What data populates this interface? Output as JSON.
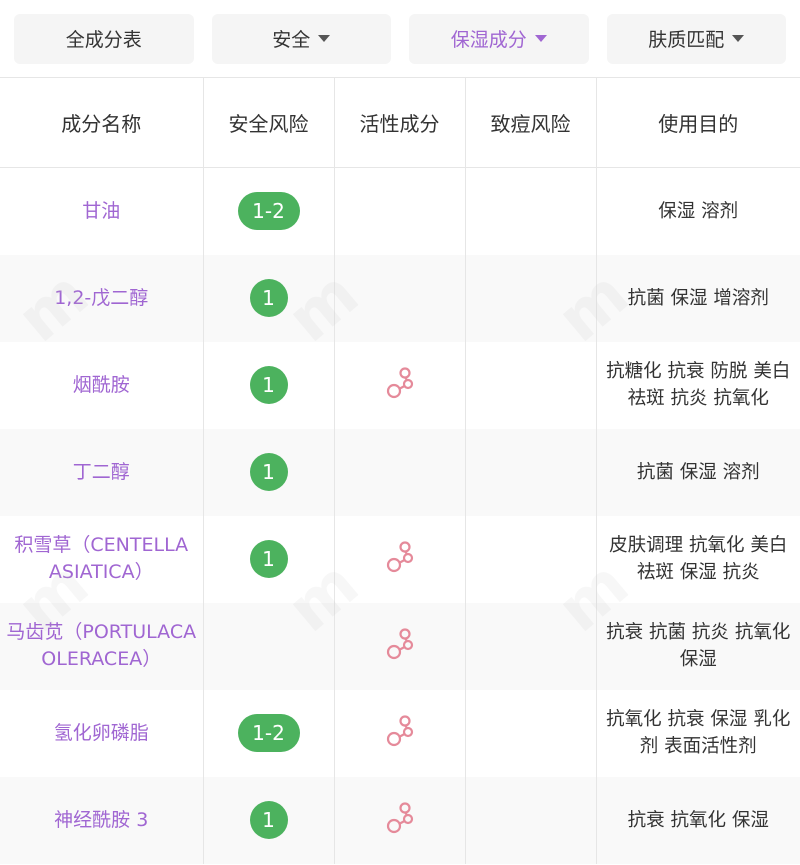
{
  "filters": [
    {
      "label": "全成分表",
      "has_caret": false,
      "active": false
    },
    {
      "label": "安全",
      "has_caret": true,
      "active": false
    },
    {
      "label": "保湿成分",
      "has_caret": true,
      "active": true
    },
    {
      "label": "肤质匹配",
      "has_caret": true,
      "active": false
    }
  ],
  "table": {
    "headers": [
      "成分名称",
      "安全风险",
      "活性成分",
      "致痘风险",
      "使用目的"
    ],
    "rows": [
      {
        "name": "甘油",
        "risk": "1-2",
        "active": false,
        "acne": "",
        "purpose": "保湿 溶剂"
      },
      {
        "name": "1,2-戊二醇",
        "risk": "1",
        "active": false,
        "acne": "",
        "purpose": "抗菌 保湿 增溶剂"
      },
      {
        "name": "烟酰胺",
        "risk": "1",
        "active": true,
        "acne": "",
        "purpose": "抗糖化 抗衰 防脱 美白祛斑 抗炎 抗氧化"
      },
      {
        "name": "丁二醇",
        "risk": "1",
        "active": false,
        "acne": "",
        "purpose": "抗菌 保湿 溶剂"
      },
      {
        "name": "积雪草（CENTELLA ASIATICA）",
        "risk": "1",
        "active": true,
        "acne": "",
        "purpose": "皮肤调理 抗氧化 美白祛斑 保湿 抗炎"
      },
      {
        "name": "马齿苋（PORTULACA OLERACEA）",
        "risk": "",
        "active": true,
        "acne": "",
        "purpose": "抗衰 抗菌 抗炎 抗氧化 保湿"
      },
      {
        "name": "氢化卵磷脂",
        "risk": "1-2",
        "active": true,
        "acne": "",
        "purpose": "抗氧化 抗衰 保湿 乳化剂 表面活性剂"
      },
      {
        "name": "神经酰胺 3",
        "risk": "1",
        "active": true,
        "acne": "",
        "purpose": "抗衰 抗氧化 保湿"
      }
    ]
  },
  "icons": {
    "active_ingredient": "molecule-icon",
    "caret": "caret-down-icon"
  },
  "colors": {
    "accent": "#a066d2",
    "risk_badge": "#4cb25e",
    "active_icon": "#e58a9a"
  }
}
